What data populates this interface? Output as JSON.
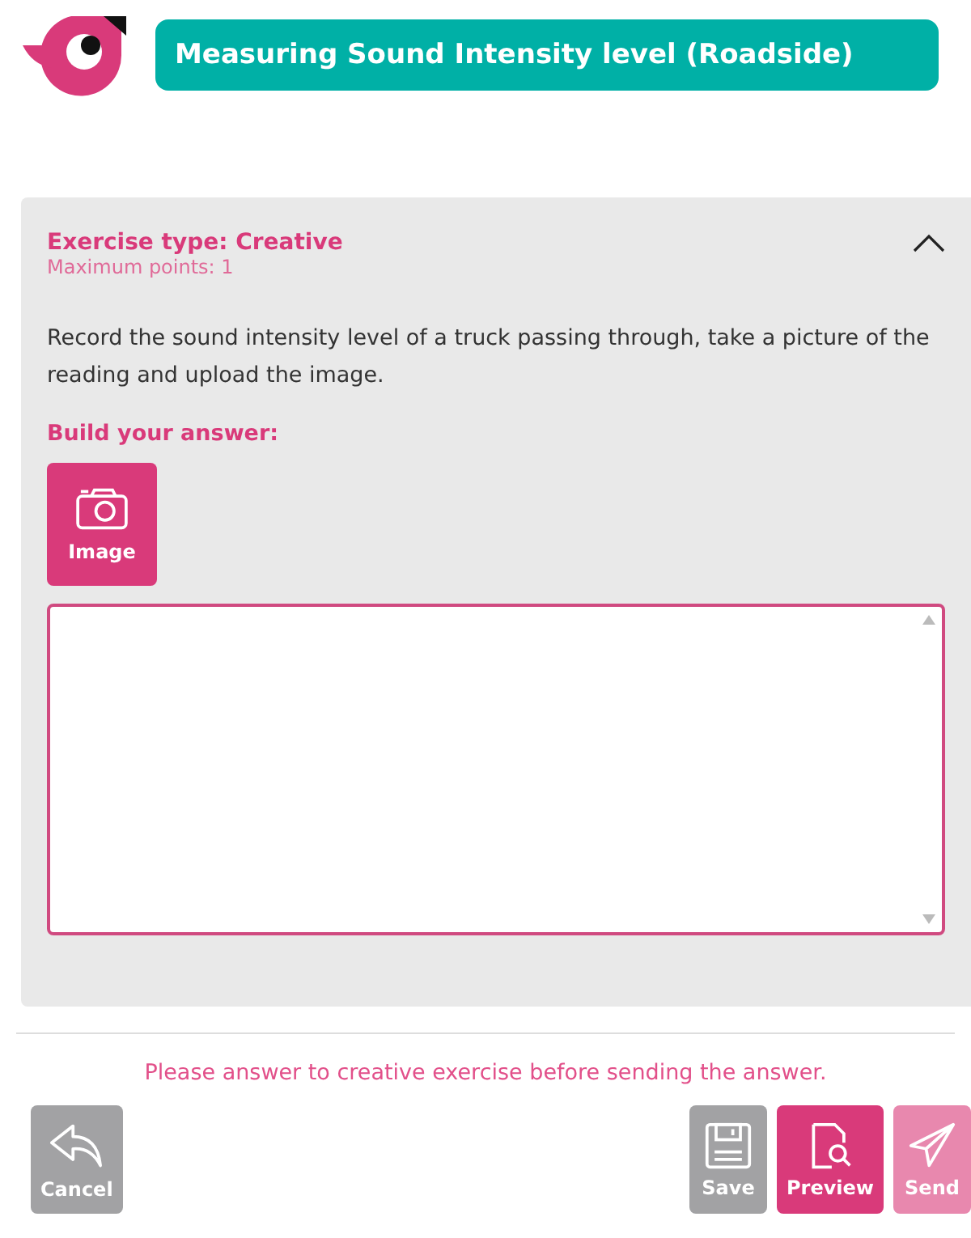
{
  "header": {
    "title": "Measuring Sound Intensity level (Roadside)"
  },
  "exercise": {
    "type_label": "Exercise type: Creative",
    "points": "Maximum points: 1",
    "expanded": true,
    "instructions": "Record the sound intensity level of a truck passing through, take a picture of the reading and upload the image.",
    "build_label": "Build your answer:",
    "tools": [
      {
        "kind": "image",
        "label": "Image"
      }
    ]
  },
  "message": "Please answer to creative exercise before sending the answer.",
  "buttons": [
    {
      "kind": "cancel",
      "label": "Cancel",
      "disabled": false
    },
    {
      "kind": "save",
      "label": "Save",
      "disabled": false
    },
    {
      "kind": "preview",
      "label": "Preview",
      "disabled": false
    },
    {
      "kind": "send",
      "label": "Send",
      "disabled": true
    }
  ]
}
